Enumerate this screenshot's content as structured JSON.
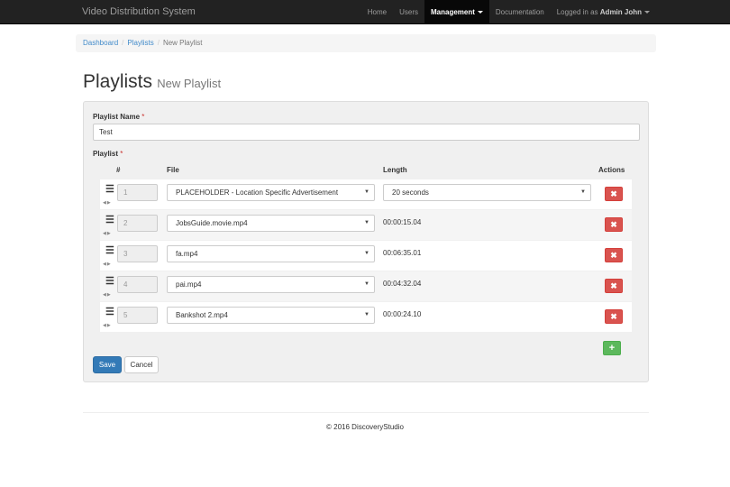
{
  "navbar": {
    "brand": "Video Distribution System",
    "items": [
      {
        "label": "Home"
      },
      {
        "label": "Users"
      },
      {
        "label": "Management"
      },
      {
        "label": "Documentation"
      }
    ],
    "user_prefix": "Logged in as",
    "user_name": "Admin John",
    "active_color": "#080808"
  },
  "breadcrumb": {
    "items": [
      "Dashboard",
      "Playlists"
    ],
    "current": "New Playlist",
    "separator": "/"
  },
  "header": {
    "title": "Playlists",
    "subtitle": "New Playlist"
  },
  "form": {
    "name_label": "Playlist Name",
    "name_value": "Test",
    "playlist_label": "Playlist",
    "required_mark": "*",
    "columns": {
      "number": "#",
      "file": "File",
      "length": "Length",
      "actions": "Actions"
    },
    "rows": [
      {
        "number": "1",
        "file": "PLACEHOLDER - Location Specific Advertisement",
        "length": "20 seconds",
        "length_is_select": true
      },
      {
        "number": "2",
        "file": "JobsGuide.movie.mp4",
        "length": "00:00:15.04",
        "length_is_select": false
      },
      {
        "number": "3",
        "file": "fa.mp4",
        "length": "00:06:35.01",
        "length_is_select": false
      },
      {
        "number": "4",
        "file": "pai.mp4",
        "length": "00:04:32.04",
        "length_is_select": false
      },
      {
        "number": "5",
        "file": "Bankshot 2.mp4",
        "length": "00:00:24.10",
        "length_is_select": false
      }
    ],
    "delete_label": "✖",
    "add_label": "+",
    "save_label": "Save",
    "cancel_label": "Cancel"
  },
  "footer": {
    "text": "© 2016 DiscoveryStudio"
  },
  "colors": {
    "primary": "#337ab7",
    "danger": "#d9534f",
    "success": "#5cb85c",
    "navbar": "#222222"
  }
}
